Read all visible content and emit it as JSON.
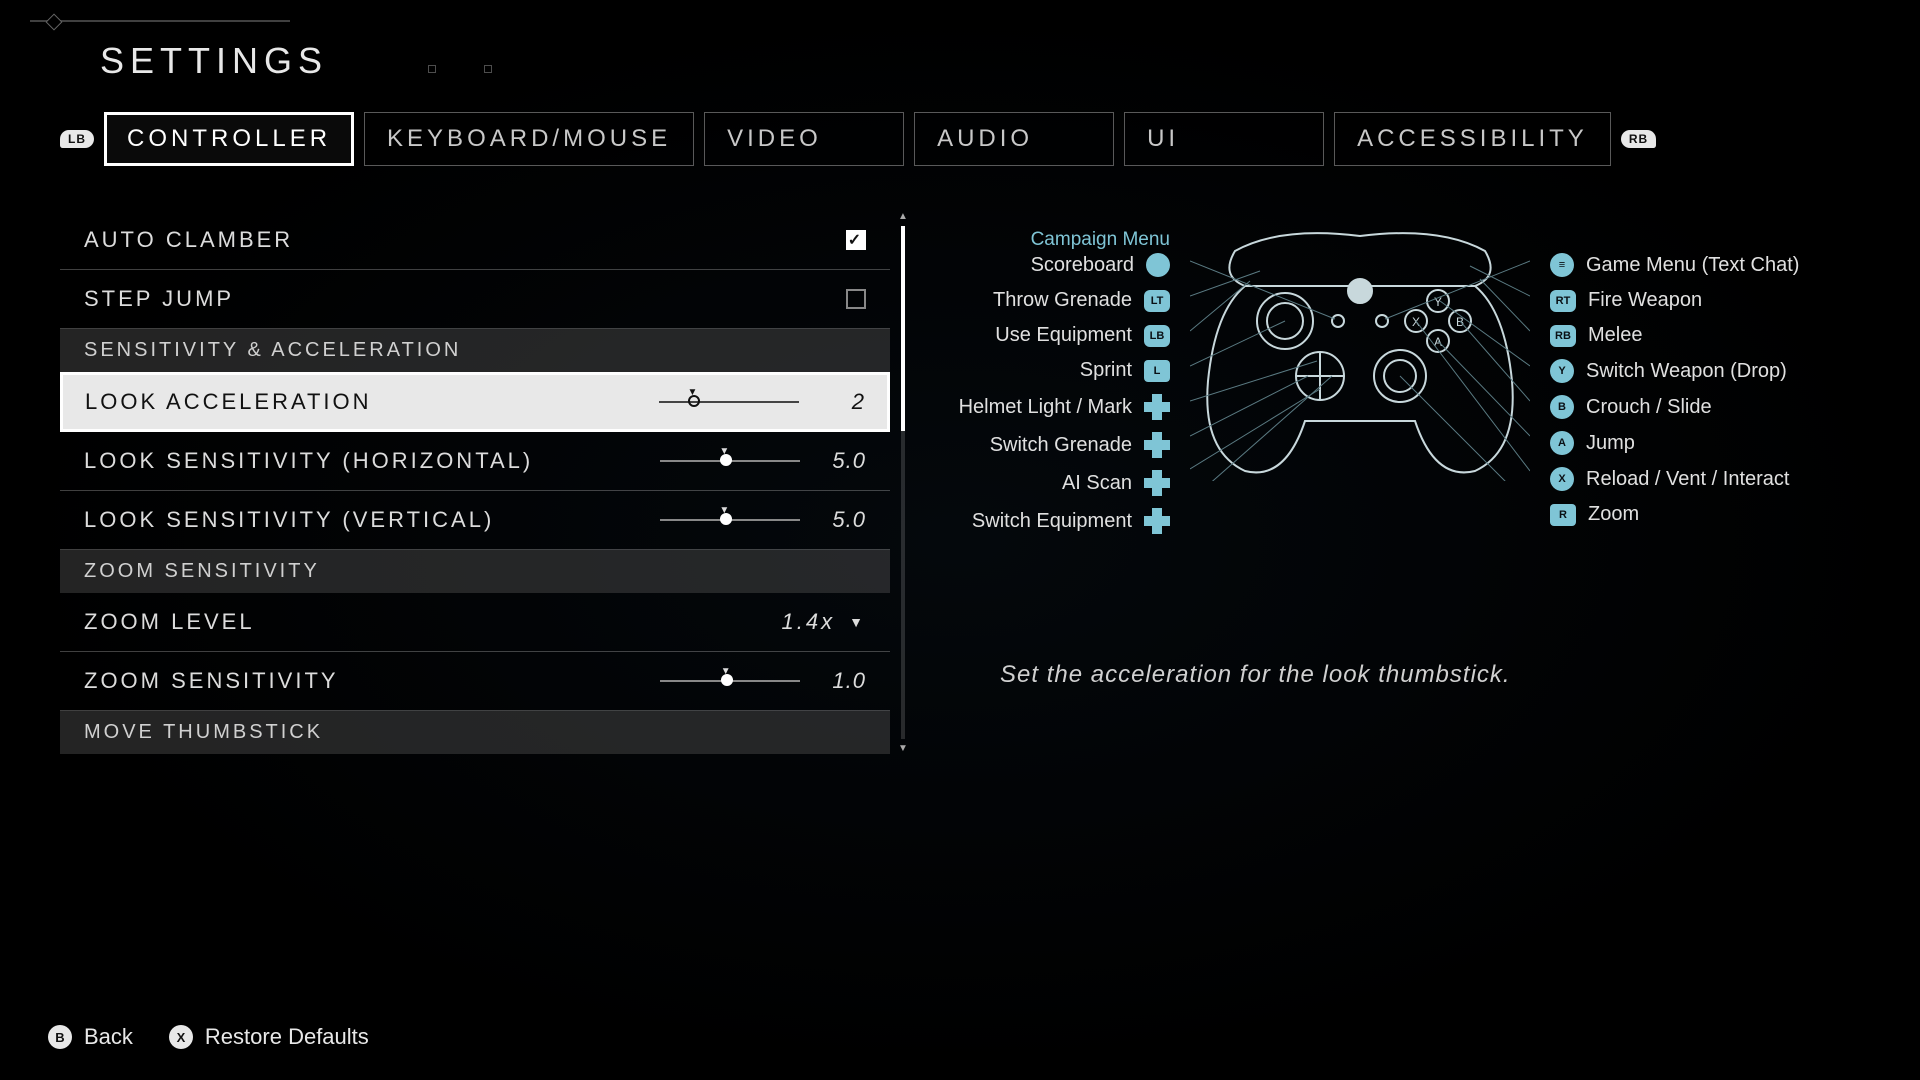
{
  "title": "SETTINGS",
  "bumpers": {
    "left": "LB",
    "right": "RB"
  },
  "tabs": [
    {
      "label": "CONTROLLER",
      "active": true
    },
    {
      "label": "KEYBOARD/MOUSE",
      "active": false
    },
    {
      "label": "VIDEO",
      "active": false
    },
    {
      "label": "AUDIO",
      "active": false
    },
    {
      "label": "UI",
      "active": false
    },
    {
      "label": "ACCESSIBILITY",
      "active": false
    }
  ],
  "settings": {
    "auto_clamber": {
      "label": "AUTO CLAMBER",
      "checked": true
    },
    "step_jump": {
      "label": "STEP JUMP",
      "checked": false
    },
    "section_sensitivity": "SENSITIVITY & ACCELERATION",
    "look_acceleration": {
      "label": "LOOK ACCELERATION",
      "value": "2",
      "pos": 25
    },
    "look_sensitivity_h": {
      "label": "LOOK SENSITIVITY (HORIZONTAL)",
      "value": "5.0",
      "pos": 47
    },
    "look_sensitivity_v": {
      "label": "LOOK SENSITIVITY (VERTICAL)",
      "value": "5.0",
      "pos": 47
    },
    "section_zoom": "ZOOM SENSITIVITY",
    "zoom_level": {
      "label": "ZOOM LEVEL",
      "value": "1.4x"
    },
    "zoom_sensitivity": {
      "label": "ZOOM SENSITIVITY",
      "value": "1.0",
      "pos": 48
    },
    "section_move": "MOVE THUMBSTICK"
  },
  "controller": {
    "left": [
      {
        "label": "Campaign Menu",
        "secondary": true
      },
      {
        "label": "Scoreboard",
        "icon": "view"
      },
      {
        "label": "Throw Grenade",
        "icon": "LT"
      },
      {
        "label": "Use Equipment",
        "icon": "LB"
      },
      {
        "label": "Sprint",
        "icon": "L"
      },
      {
        "label": "Helmet Light / Mark",
        "icon": "dpad"
      },
      {
        "label": "Switch Grenade",
        "icon": "dpad"
      },
      {
        "label": "AI Scan",
        "icon": "dpad"
      },
      {
        "label": "Switch Equipment",
        "icon": "dpad"
      }
    ],
    "right": [
      {
        "label": "Game Menu (Text Chat)",
        "icon": "menu"
      },
      {
        "label": "Fire Weapon",
        "icon": "RT"
      },
      {
        "label": "Melee",
        "icon": "RB"
      },
      {
        "label": "Switch Weapon (Drop)",
        "icon": "Y"
      },
      {
        "label": "Crouch / Slide",
        "icon": "B"
      },
      {
        "label": "Jump",
        "icon": "A"
      },
      {
        "label": "Reload / Vent / Interact",
        "icon": "X"
      },
      {
        "label": "Zoom",
        "icon": "R"
      }
    ]
  },
  "description": "Set the acceleration for the look thumbstick.",
  "footer": {
    "back": {
      "icon": "B",
      "label": "Back"
    },
    "restore": {
      "icon": "X",
      "label": "Restore Defaults"
    }
  }
}
